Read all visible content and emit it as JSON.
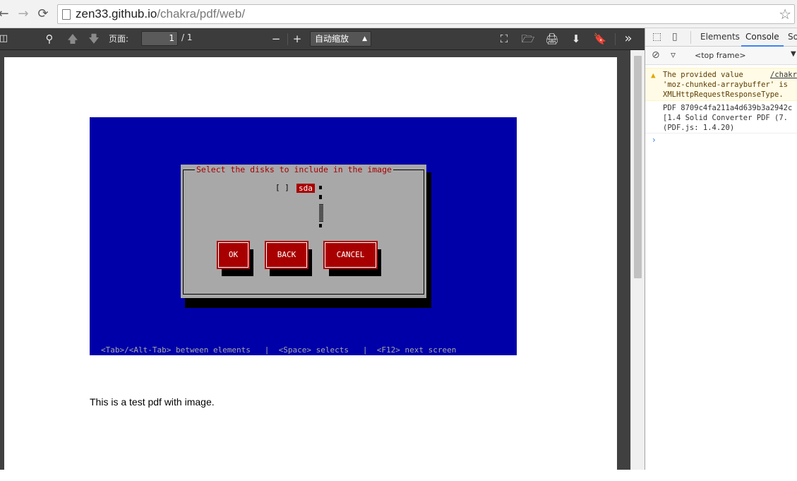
{
  "browser": {
    "url_host": "zen33.github.io",
    "url_path": "/chakra/pdf/web/",
    "back_icon": "back-arrow-icon",
    "forward_icon": "forward-arrow-icon",
    "reload_icon": "reload-icon"
  },
  "pdf_toolbar": {
    "page_label": "页面:",
    "page_value": "1",
    "page_total": "/ 1",
    "zoom_minus": "−",
    "zoom_plus": "+",
    "zoom_value": "自动缩放",
    "more": "»"
  },
  "pdf_page": {
    "image": {
      "dialog_title": "Select the disks to include in the image",
      "checkbox": "[ ]",
      "disk_item": "sda",
      "buttons": [
        "OK",
        "BACK",
        "CANCEL"
      ],
      "status_line": "<Tab>/<Alt-Tab> between elements   |  <Space> selects   |  <F12> next screen",
      "colors": {
        "background": "#0000a8",
        "dialog": "#a8a8a8",
        "accent": "#a80000"
      }
    },
    "caption": "This is a test pdf with image."
  },
  "devtools": {
    "tabs": [
      "Elements",
      "Console",
      "So"
    ],
    "active_tab": "Console",
    "context": "<top frame>",
    "messages": [
      {
        "level": "warning",
        "lines": [
          "The provided value",
          "'moz-chunked-arraybuffer' is",
          "XMLHttpRequestResponseType."
        ],
        "source": "/chakr"
      },
      {
        "level": "log",
        "lines": [
          "PDF 8709c4fa211a4d639b3a2942c",
          "[1.4 Solid Converter PDF  (7.",
          "(PDF.js: 1.4.20)"
        ]
      }
    ],
    "prompt": "›"
  }
}
